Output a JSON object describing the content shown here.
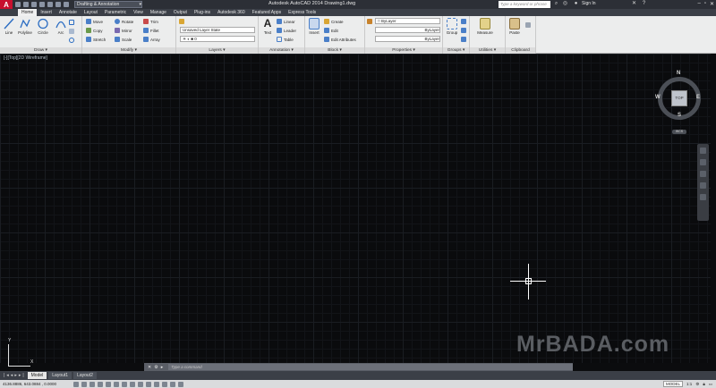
{
  "titlebar": {
    "app_logo": "A",
    "workspace": "Drafting & Annotation",
    "title": "Autodesk AutoCAD 2014    Drawing1.dwg",
    "search_placeholder": "Type a keyword or phrase",
    "signin": "Sign In"
  },
  "tabs": [
    "Home",
    "Insert",
    "Annotate",
    "Layout",
    "Parametric",
    "View",
    "Manage",
    "Output",
    "Plug-ins",
    "Autodesk 360",
    "Featured Apps",
    "Express Tools"
  ],
  "ribbon": {
    "draw": {
      "title": "Draw",
      "line": "Line",
      "polyline": "Polyline",
      "circle": "Circle",
      "arc": "Arc"
    },
    "modify": {
      "title": "Modify",
      "move": "Move",
      "rotate": "Rotate",
      "trim": "Trim",
      "copy": "Copy",
      "mirror": "Mirror",
      "fillet": "Fillet",
      "stretch": "Stretch",
      "scale": "Scale",
      "array": "Array"
    },
    "layers": {
      "title": "Layers",
      "layer_state": "Unsaved Layer State",
      "current_layer": "0"
    },
    "annotation": {
      "title": "Annotation",
      "text": "Text",
      "linear": "Linear",
      "leader": "Leader",
      "table": "Table"
    },
    "block": {
      "title": "Block",
      "insert": "Insert",
      "create": "Create",
      "edit": "Edit",
      "edit_attributes": "Edit Attributes"
    },
    "properties": {
      "title": "Properties",
      "color": "ByLayer",
      "linetype": "ByLayer",
      "lineweight": "ByLayer"
    },
    "groups": {
      "title": "Groups",
      "group": "Group"
    },
    "utilities": {
      "title": "Utilities",
      "measure": "Measure"
    },
    "clipboard": {
      "title": "Clipboard",
      "paste": "Paste"
    }
  },
  "canvas": {
    "viewport_label": "[-][Top][2D Wireframe]",
    "viewcube": {
      "top": "TOP",
      "n": "N",
      "s": "S",
      "e": "E",
      "w": "W",
      "wcs": "WCS"
    },
    "watermark": "MrBADA.com",
    "ucs_x": "X",
    "ucs_y": "Y"
  },
  "command_line": {
    "placeholder": "Type a command"
  },
  "layout_tabs": [
    "Model",
    "Layout1",
    "Layout2"
  ],
  "status": {
    "coordinates": "4136.8886, 643.0884 , 0.0000",
    "model": "MODEL",
    "scale": "1:1"
  }
}
